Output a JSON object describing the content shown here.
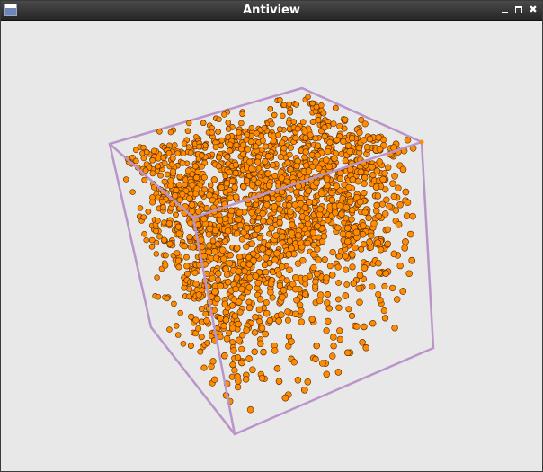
{
  "window": {
    "title": "Antiview"
  },
  "titlebar": {
    "minimize_icon": "minimize-icon",
    "maximize_icon": "maximize-icon",
    "close_icon": "close-icon",
    "close_glyph": "✖"
  },
  "scene": {
    "box_color": "#b995c9",
    "particle_color": "#ff8c00",
    "particle_edge_color": "#5a2a00",
    "background": "#e8e8e8"
  }
}
